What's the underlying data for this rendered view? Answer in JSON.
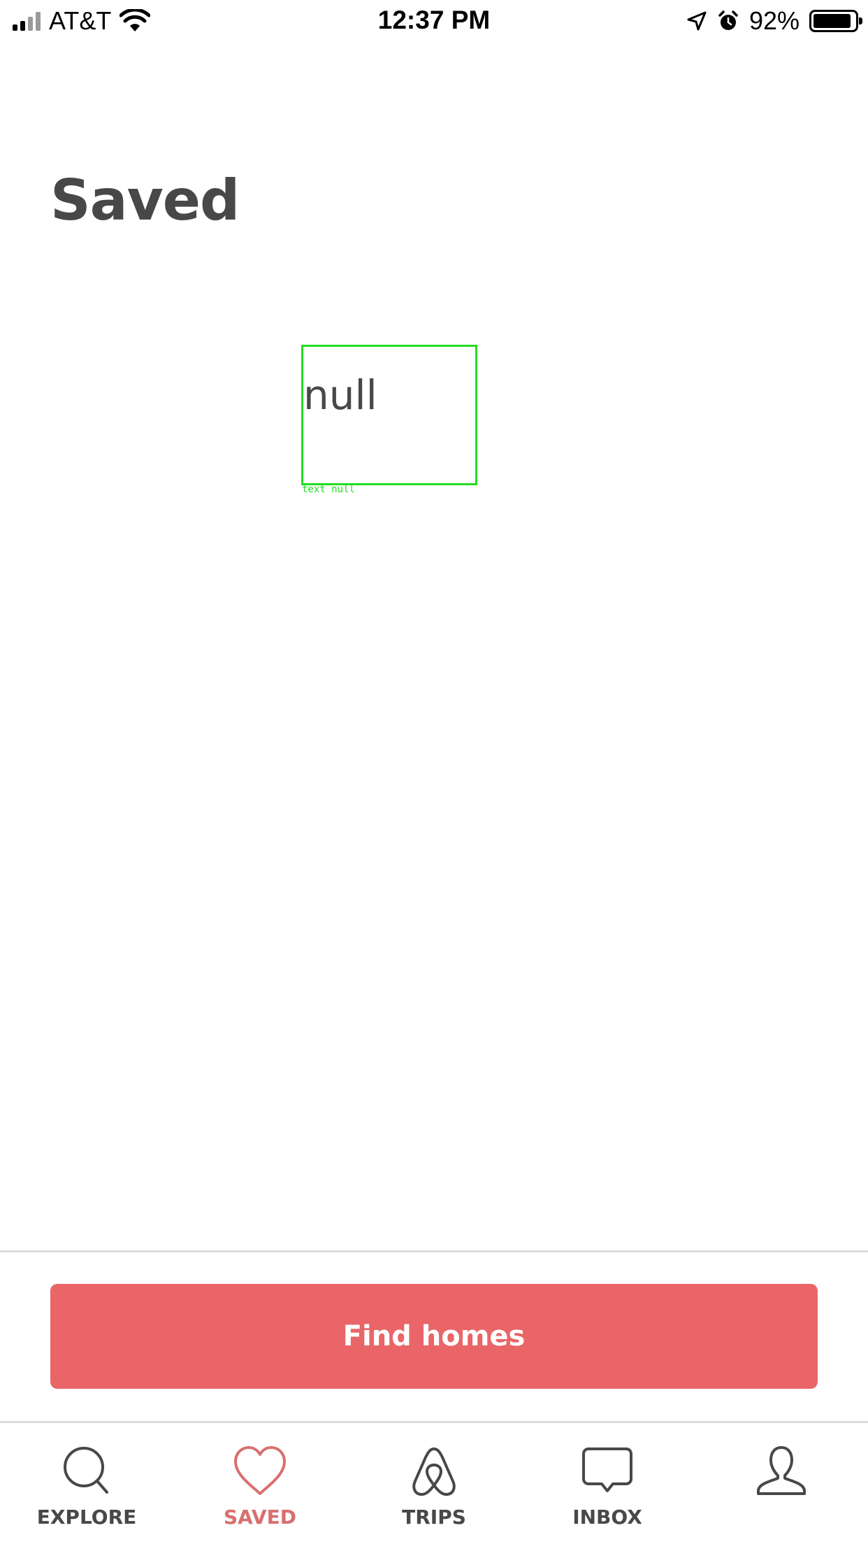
{
  "status_bar": {
    "carrier": "AT&T",
    "time": "12:37 PM",
    "battery_percent": "92%",
    "battery_level": 0.92,
    "icons": [
      "signal-icon",
      "wifi-icon",
      "location-arrow-icon",
      "alarm-icon",
      "battery-icon"
    ]
  },
  "page": {
    "title": "Saved"
  },
  "placeholder": {
    "text": "null",
    "caption": "text null",
    "outline_color": "#22dd22"
  },
  "actions": {
    "find_homes_label": "Find homes",
    "button_color": "#e96567"
  },
  "tab_bar": {
    "active_color": "#d86f6f",
    "tabs": [
      {
        "label": "EXPLORE",
        "icon": "search-icon",
        "active": false
      },
      {
        "label": "SAVED",
        "icon": "heart-icon",
        "active": true
      },
      {
        "label": "TRIPS",
        "icon": "airbnb-logo-icon",
        "active": false
      },
      {
        "label": "INBOX",
        "icon": "chat-bubble-icon",
        "active": false
      },
      {
        "label": "",
        "icon": "profile-icon",
        "active": false
      }
    ]
  }
}
